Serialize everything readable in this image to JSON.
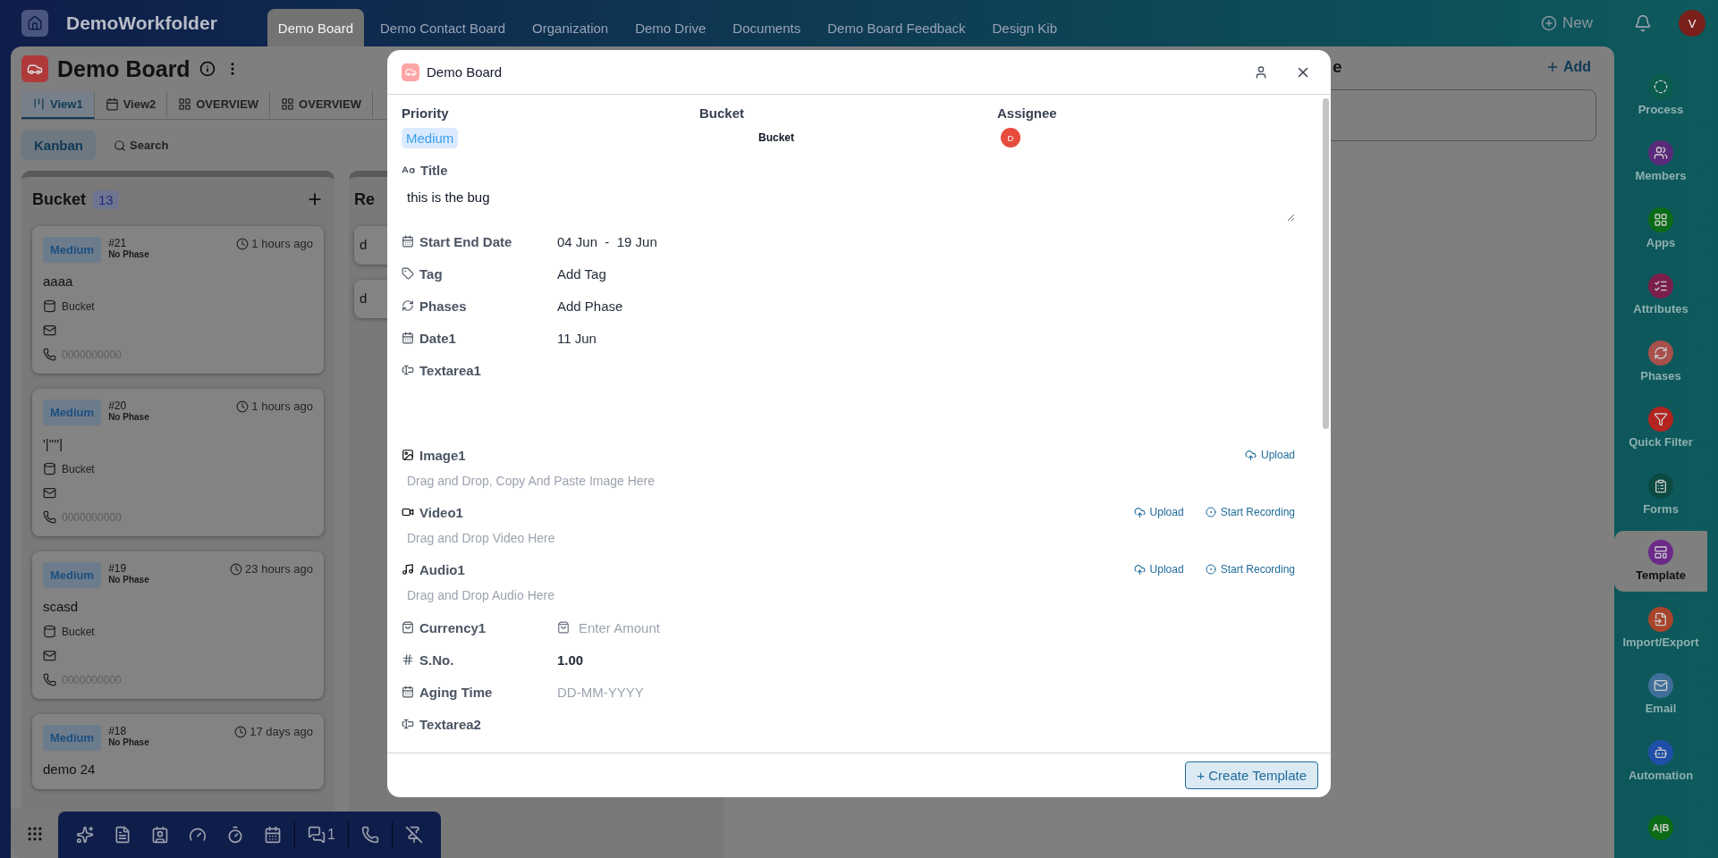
{
  "top_bar": {
    "workspace": "DemoWorkfolder",
    "tabs": [
      {
        "label": "Demo Board",
        "selected": true
      },
      {
        "label": "Demo Contact Board",
        "selected": false
      },
      {
        "label": "Organization",
        "selected": false
      },
      {
        "label": "Demo Drive",
        "selected": false
      },
      {
        "label": "Documents",
        "selected": false
      },
      {
        "label": "Demo Board Feedback",
        "selected": false
      },
      {
        "label": "Design Kib",
        "selected": false
      }
    ],
    "new_button": "New",
    "avatar": "V"
  },
  "board": {
    "title": "Demo Board",
    "views": [
      {
        "label": "View1",
        "kind": "board",
        "selected": true
      },
      {
        "label": "View2",
        "kind": "calendar",
        "selected": false
      },
      {
        "label": "OVERVIEW",
        "kind": "grid",
        "selected": false
      },
      {
        "label": "OVERVIEW",
        "kind": "grid",
        "selected": false
      }
    ],
    "mode_button": "Kanban",
    "search": "Search",
    "columns": [
      {
        "title": "Bucket",
        "count": "13",
        "cards": [
          {
            "priority": "Medium",
            "number": "#21",
            "phase": "No Phase",
            "time": "1 hours ago",
            "title": "aaaa",
            "bucket": "Bucket",
            "phone": "0000000000"
          },
          {
            "priority": "Medium",
            "number": "#20",
            "phase": "No Phase",
            "time": "1 hours ago",
            "title": "'|''''|",
            "bucket": "Bucket",
            "phone": "0000000000"
          },
          {
            "priority": "Medium",
            "number": "#19",
            "phase": "No Phase",
            "time": "23 hours ago",
            "title": "scasd",
            "bucket": "Bucket",
            "phone": "0000000000"
          },
          {
            "priority": "Medium",
            "number": "#18",
            "phase": "No Phase",
            "time": "17 days ago",
            "title": "demo 24"
          }
        ]
      },
      {
        "title": "Re",
        "cards": [
          {
            "title": "d"
          },
          {
            "title": "d"
          }
        ]
      }
    ]
  },
  "side_panel": {
    "title": "e",
    "add_button": "Add"
  },
  "sidebar": {
    "items": [
      {
        "label": "Process",
        "kind": "process",
        "color": "#0a5c4d",
        "selected": false
      },
      {
        "label": "Members",
        "kind": "members",
        "color": "#5a2a7a",
        "selected": false
      },
      {
        "label": "Apps",
        "kind": "apps",
        "color": "#0b6b16",
        "selected": false
      },
      {
        "label": "Attributes",
        "kind": "attributes",
        "color": "#7a1f4c",
        "selected": false
      },
      {
        "label": "Phases",
        "kind": "phases",
        "color": "#a8504b",
        "selected": false
      },
      {
        "label": "Quick Filter",
        "kind": "filter",
        "color": "#b3231f",
        "selected": false
      },
      {
        "label": "Forms",
        "kind": "forms",
        "color": "#0c4a42",
        "selected": false
      },
      {
        "label": "Template",
        "kind": "template",
        "color": "#6b2a8a",
        "selected": true
      },
      {
        "label": "Import/Export",
        "kind": "import",
        "color": "#a8442a",
        "selected": false
      },
      {
        "label": "Email",
        "kind": "email",
        "color": "#3f6f99",
        "selected": false
      },
      {
        "label": "Automation",
        "kind": "automation",
        "color": "#1f4fa8",
        "selected": false
      },
      {
        "glyph": "A|B",
        "kind": "ab",
        "color": "#0b6b16",
        "selected": false
      }
    ]
  },
  "dock": {
    "chat_count": "1"
  },
  "modal": {
    "title": "Demo Board",
    "summary": [
      {
        "label": "Priority",
        "kind": "badge",
        "value": "Medium"
      },
      {
        "label": "Bucket",
        "kind": "text",
        "value": "Bucket"
      },
      {
        "label": "Assignee",
        "kind": "avatar",
        "value": "D"
      }
    ],
    "title_field": {
      "label": "Title",
      "value": "this is the bug"
    },
    "fields": [
      {
        "kind": "date_range",
        "label": "Start End Date",
        "value": "04 Jun  -  19 Jun"
      },
      {
        "kind": "tag",
        "label": "Tag",
        "value": "Add Tag"
      },
      {
        "kind": "phase",
        "label": "Phases",
        "value": "Add Phase"
      },
      {
        "kind": "date",
        "label": "Date1",
        "value": "11 Jun"
      },
      {
        "kind": "textarea",
        "label": "Textarea1"
      },
      {
        "kind": "image",
        "label": "Image1",
        "hint": "Drag and Drop, Copy And Paste Image Here",
        "actions": [
          {
            "kind": "upload",
            "label": "Upload"
          }
        ]
      },
      {
        "kind": "video",
        "label": "Video1",
        "hint": "Drag and Drop Video Here",
        "actions": [
          {
            "kind": "upload",
            "label": "Upload"
          },
          {
            "kind": "record",
            "label": "Start Recording"
          }
        ]
      },
      {
        "kind": "audio",
        "label": "Audio1",
        "hint": "Drag and Drop Audio Here",
        "actions": [
          {
            "kind": "upload",
            "label": "Upload"
          },
          {
            "kind": "record",
            "label": "Start Recording"
          }
        ]
      },
      {
        "kind": "currency",
        "label": "Currency1",
        "placeholder": "Enter Amount"
      },
      {
        "kind": "number",
        "label": "S.No.",
        "value": "1.00"
      },
      {
        "kind": "aging",
        "label": "Aging Time",
        "placeholder": "DD-MM-YYYY"
      },
      {
        "kind": "textarea",
        "label": "Textarea2"
      }
    ],
    "create_button": "+ Create Template"
  }
}
